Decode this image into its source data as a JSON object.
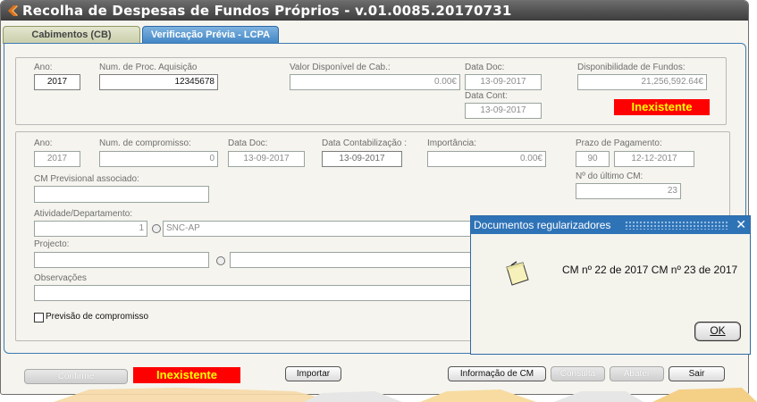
{
  "window": {
    "title": "Recolha de Despesas de Fundos Próprios - v.01.0085.20170731"
  },
  "tabs": [
    {
      "label": "Cabimentos (CB)",
      "active": false
    },
    {
      "label": "Verificação Prévia - LCPA",
      "active": true
    }
  ],
  "top_section": {
    "ano_label": "Ano:",
    "ano_value": "2017",
    "proc_label": "Num. de Proc. Aquisição",
    "proc_value": "12345678",
    "valor_label": "Valor Disponível de Cab.:",
    "valor_value": "0.00€",
    "data_doc_label": "Data Doc:",
    "data_doc_value": "13-09-2017",
    "data_cont_label": "Data Cont:",
    "data_cont_value": "13-09-2017",
    "disp_label": "Disponibilidade de Fundos:",
    "disp_value": "21,256,592.64€",
    "status": "Inexistente"
  },
  "commitment_section": {
    "ano_label": "Ano:",
    "ano_value": "2017",
    "num_label": "Num. de compromisso:",
    "num_value": "0",
    "data_doc_label": "Data Doc:",
    "data_doc_value": "13-09-2017",
    "data_contab_label": "Data Contabilização :",
    "data_contab_value": "13-09-2017",
    "importancia_label": "Importância:",
    "importancia_value": "0.00€",
    "prazo_label": "Prazo de Pagamento:",
    "prazo_days": "90",
    "prazo_date": "12-12-2017",
    "cm_prev_label": "CM Previsional associado:",
    "cm_prev_value": "",
    "ultimo_cm_label": "Nº do último CM:",
    "ultimo_cm_value": "23",
    "atividade_label": "Atividade/Departamento:",
    "atividade_code": "1",
    "atividade_name": "SNC-AP",
    "projecto_label": "Projecto:",
    "projecto_code": "",
    "projecto_name": "",
    "observacoes_label": "Observações",
    "observacoes_value": "",
    "previsao_label": "Previsão de compromisso",
    "previsao_checked": false
  },
  "footer": {
    "confirme_label": "Confirme",
    "status": "Inexistente",
    "importar_label": "Importar",
    "info_cm_label": "Informação de CM",
    "consulta_label": "Consulta",
    "abater_label": "Abater",
    "sair_label": "Sair"
  },
  "popup": {
    "title": "Documentos regularizadores",
    "close_icon": "close-icon",
    "message": "CM nº 22 de 2017 CM nº 23 de 2017",
    "ok_label": "OK"
  },
  "colors": {
    "title_bar": "#4a4a4a",
    "active_tab": "#3f84c4",
    "status_bg": "#ff0000",
    "status_text": "#ffff00",
    "popup_title": "#2f73b7"
  }
}
